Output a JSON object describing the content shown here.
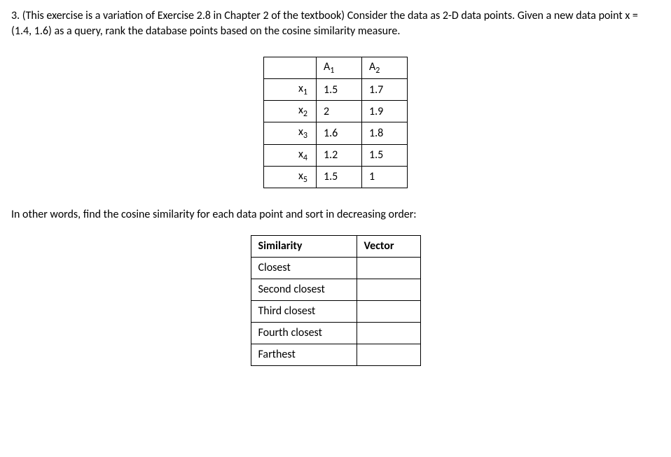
{
  "question": {
    "prefix": "3. (This exercise is a variation of Exercise 2.8 in Chapter 2 of the textbook) Consider the data as 2-D data points. Given a new data point x = (1.4, 1.6) as a query, rank the database points based on the cosine similarity measure."
  },
  "data_table": {
    "header_a1_base": "A",
    "header_a1_sub": "1",
    "header_a2_base": "A",
    "header_a2_sub": "2",
    "rows": [
      {
        "label_base": "x",
        "label_sub": "1",
        "a1": "1.5",
        "a2": "1.7"
      },
      {
        "label_base": "x",
        "label_sub": "2",
        "a1": "2",
        "a2": "1.9"
      },
      {
        "label_base": "x",
        "label_sub": "3",
        "a1": "1.6",
        "a2": "1.8"
      },
      {
        "label_base": "x",
        "label_sub": "4",
        "a1": "1.2",
        "a2": "1.5"
      },
      {
        "label_base": "x",
        "label_sub": "5",
        "a1": "1.5",
        "a2": "1"
      }
    ]
  },
  "instruction": "In other words, find the cosine similarity for each data point and sort in decreasing order:",
  "rank_table": {
    "header_similarity": "Similarity",
    "header_vector": "Vector",
    "rows": [
      {
        "label": "Closest",
        "vector": ""
      },
      {
        "label": "Second closest",
        "vector": ""
      },
      {
        "label": "Third closest",
        "vector": ""
      },
      {
        "label": "Fourth closest",
        "vector": ""
      },
      {
        "label": "Farthest",
        "vector": ""
      }
    ]
  }
}
